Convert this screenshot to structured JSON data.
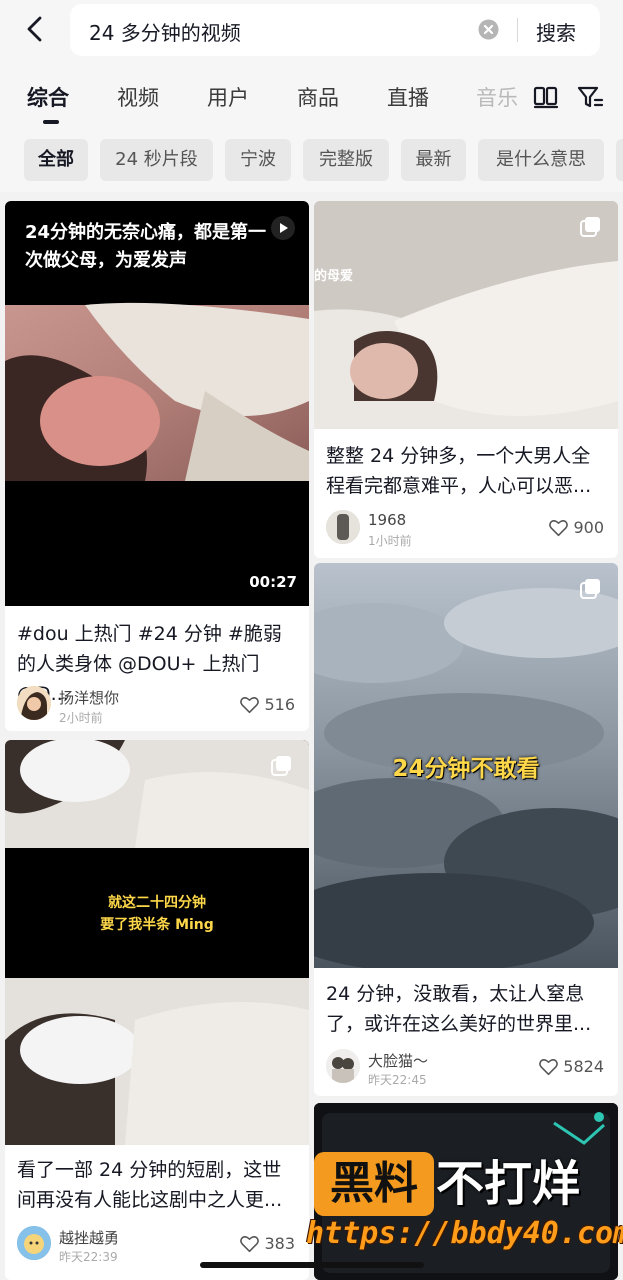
{
  "search": {
    "query": "24 多分钟的视频",
    "submit_label": "搜索"
  },
  "tabs": [
    "综合",
    "视频",
    "用户",
    "商品",
    "直播",
    "音乐"
  ],
  "active_tab": "综合",
  "chips": [
    "全部",
    "24 秒片段",
    "宁波",
    "完整版",
    "最新",
    "是什么意思"
  ],
  "active_chip": "全部",
  "icons": {
    "back": "back-arrow-icon",
    "clear": "clear-circle-icon",
    "view": "double-column-view-icon",
    "filter": "filter-icon",
    "like": "heart-outline-icon",
    "play": "play-icon",
    "gallery": "image-set-icon"
  },
  "cards": [
    {
      "overlay_caption": "24分钟的无奈心痛，都是第一次做父母，为爱发声",
      "duration": "00:27",
      "description": "#dou 上热门 #24 分钟 #脆弱的人类身体 @DOU+ 上热门 @D...",
      "author": "扬洋想你",
      "time": "2小时前",
      "likes": "516"
    },
    {
      "overlay_caption": "的母爱",
      "description": "整整 24 分钟多，一个大男人全程看完都意难平，人心可以恶...",
      "author": "1968",
      "time": "1小时前",
      "likes": "900"
    },
    {
      "overlay_caption": "24分钟不敢看",
      "description": "24 分钟，没敢看，太让人窒息了，或许在这么美好的世界里...",
      "author": "大脸猫～",
      "time": "昨天22:45",
      "likes": "5824"
    },
    {
      "overlay_caption_line1": "就这二十四分钟",
      "overlay_caption_line2": "要了我半条 Ming",
      "description": "看了一部 24 分钟的短剧，这世间再没有人能比这剧中之人更...",
      "author": "越挫越勇",
      "time": "昨天22:39",
      "likes": "383"
    }
  ],
  "watermark": {
    "left": "黑料",
    "right": "不打烊",
    "url": "https://bbdy40.com"
  },
  "colors": {
    "accent_text": "#161823",
    "chip_bg": "#e8e8e8",
    "page_bg": "#f2f2f2",
    "caption_yellow": "#ffd84a",
    "watermark_orange": "#f39a1f"
  }
}
